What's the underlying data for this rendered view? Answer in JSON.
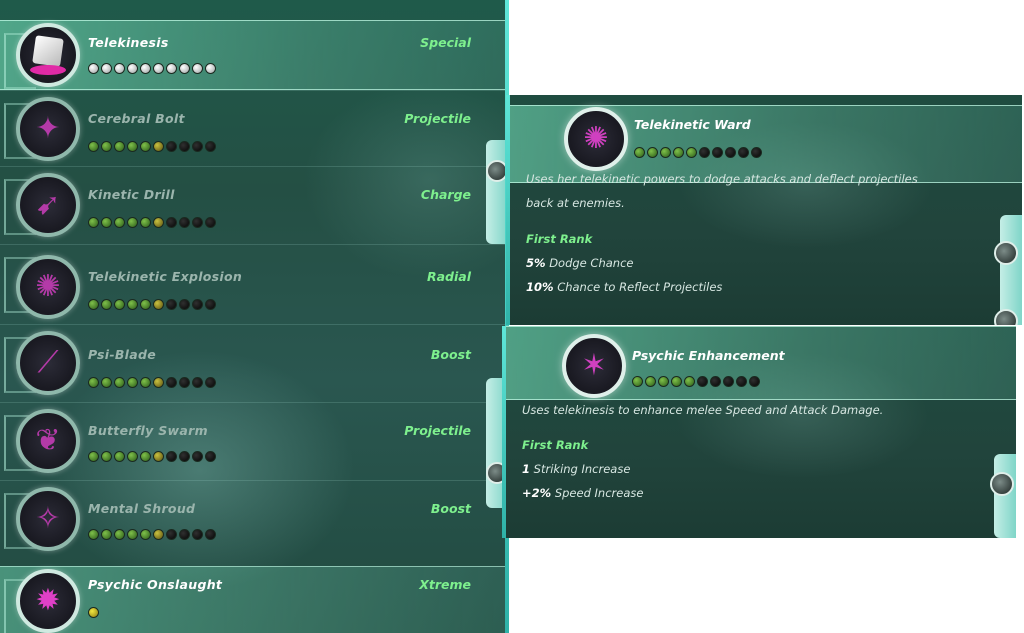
{
  "power_list": {
    "items": [
      {
        "name": "Telekinesis",
        "type": "Special",
        "icon": "telekinesis-cube-icon",
        "pips": [
          "silver",
          "silver",
          "silver",
          "silver",
          "silver",
          "silver",
          "silver",
          "silver",
          "silver",
          "silver"
        ]
      },
      {
        "name": "Cerebral Bolt",
        "type": "Projectile",
        "icon": "cerebral-bolt-icon",
        "pips": [
          "green",
          "green",
          "green",
          "green",
          "green",
          "gold",
          "black",
          "black",
          "black",
          "black"
        ]
      },
      {
        "name": "Kinetic Drill",
        "type": "Charge",
        "icon": "kinetic-drill-icon",
        "pips": [
          "green",
          "green",
          "green",
          "green",
          "green",
          "gold",
          "black",
          "black",
          "black",
          "black"
        ]
      },
      {
        "name": "Telekinetic Explosion",
        "type": "Radial",
        "icon": "telekinetic-explosion-icon",
        "pips": [
          "green",
          "green",
          "green",
          "green",
          "green",
          "gold",
          "black",
          "black",
          "black",
          "black"
        ]
      },
      {
        "name": "Psi-Blade",
        "type": "Boost",
        "icon": "psi-blade-icon",
        "pips": [
          "green",
          "green",
          "green",
          "green",
          "green",
          "gold",
          "black",
          "black",
          "black",
          "black"
        ]
      },
      {
        "name": "Butterfly Swarm",
        "type": "Projectile",
        "icon": "butterfly-swarm-icon",
        "pips": [
          "green",
          "green",
          "green",
          "green",
          "green",
          "gold",
          "black",
          "black",
          "black",
          "black"
        ]
      },
      {
        "name": "Mental Shroud",
        "type": "Boost",
        "icon": "mental-shroud-icon",
        "pips": [
          "green",
          "green",
          "green",
          "green",
          "green",
          "gold",
          "black",
          "black",
          "black",
          "black"
        ]
      },
      {
        "name": "Psychic Onslaught",
        "type": "Xtreme",
        "icon": "psychic-onslaught-icon",
        "pips": [
          "yellow"
        ]
      }
    ]
  },
  "detail_cards": [
    {
      "title": "Telekinetic Ward",
      "icon": "telekinetic-ward-icon",
      "pips": [
        "green",
        "green",
        "green",
        "green",
        "green",
        "black",
        "black",
        "black",
        "black",
        "black"
      ],
      "description": "Uses her telekinetic powers to dodge attacks and deflect projectiles back at enemies.",
      "rank_label": "First Rank",
      "stats": [
        {
          "value": "5%",
          "text": "Dodge Chance"
        },
        {
          "value": "10%",
          "text": "Chance to Reflect Projectiles"
        }
      ]
    },
    {
      "title": "Psychic Enhancement",
      "icon": "psychic-enhancement-icon",
      "pips": [
        "green",
        "green",
        "green",
        "green",
        "green",
        "black",
        "black",
        "black",
        "black",
        "black"
      ],
      "description": "Uses telekinesis to enhance melee Speed and Attack Damage.",
      "rank_label": "First Rank",
      "stats": [
        {
          "value": "1",
          "text": "Striking Increase"
        },
        {
          "value": "+2%",
          "text": "Speed Increase"
        }
      ]
    }
  ],
  "colors": {
    "accent_green": "#7ef08e",
    "power_magenta": "#b43aa8",
    "edge_cyan": "#5fe6d8"
  }
}
